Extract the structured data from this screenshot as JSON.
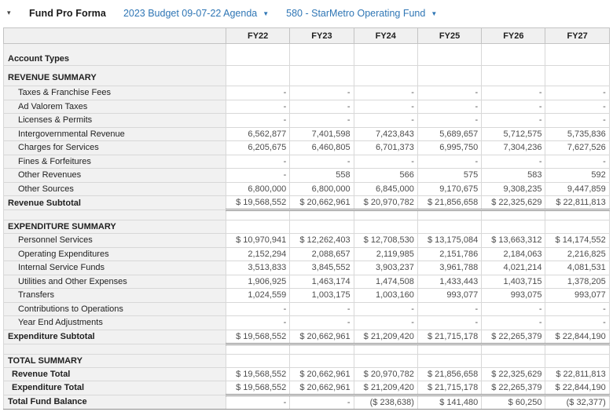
{
  "toolbar": {
    "collapse_icon": "▾",
    "title": "Fund Pro Forma",
    "budget_dropdown": {
      "label": "2023 Budget 09-07-22 Agenda",
      "caret": "▼"
    },
    "fund_dropdown": {
      "label": "580 - StarMetro Operating Fund",
      "caret": "▼"
    }
  },
  "colors": {
    "link_blue": "#2f76b5",
    "label_bg": "#f1f1f1",
    "header_bg": "#f0f0f0",
    "value_text": "#4d4d4d",
    "dark_rule": "#8f8f8f"
  },
  "table": {
    "columns": [
      "FY22",
      "FY23",
      "FY24",
      "FY25",
      "FY26",
      "FY27"
    ],
    "rows": [
      {
        "type": "account",
        "label": "Account Types",
        "values": [
          "",
          "",
          "",
          "",
          "",
          ""
        ]
      },
      {
        "type": "group_first",
        "label": "REVENUE SUMMARY",
        "values": [
          "",
          "",
          "",
          "",
          "",
          ""
        ]
      },
      {
        "type": "item",
        "label": "Taxes & Franchise Fees",
        "values": [
          "-",
          "-",
          "-",
          "-",
          "-",
          "-"
        ]
      },
      {
        "type": "item",
        "label": "Ad Valorem Taxes",
        "values": [
          "-",
          "-",
          "-",
          "-",
          "-",
          "-"
        ]
      },
      {
        "type": "item",
        "label": "Licenses & Permits",
        "values": [
          "-",
          "-",
          "-",
          "-",
          "-",
          "-"
        ]
      },
      {
        "type": "item",
        "label": "Intergovernmental Revenue",
        "values": [
          "6,562,877",
          "7,401,598",
          "7,423,843",
          "5,689,657",
          "5,712,575",
          "5,735,836"
        ]
      },
      {
        "type": "item",
        "label": "Charges for Services",
        "values": [
          "6,205,675",
          "6,460,805",
          "6,701,373",
          "6,995,750",
          "7,304,236",
          "7,627,526"
        ]
      },
      {
        "type": "item",
        "label": "Fines & Forfeitures",
        "values": [
          "-",
          "-",
          "-",
          "-",
          "-",
          "-"
        ]
      },
      {
        "type": "item",
        "label": "Other Revenues",
        "values": [
          "-",
          "558",
          "566",
          "575",
          "583",
          "592"
        ]
      },
      {
        "type": "item",
        "label": "Other Sources",
        "values": [
          "6,800,000",
          "6,800,000",
          "6,845,000",
          "9,170,675",
          "9,308,235",
          "9,447,859"
        ]
      },
      {
        "type": "subtotal",
        "label": "Revenue Subtotal",
        "values": [
          "$ 19,568,552",
          "$ 20,662,961",
          "$ 20,970,782",
          "$ 21,856,658",
          "$ 22,325,629",
          "$ 22,811,813"
        ]
      },
      {
        "type": "spacer",
        "label": "",
        "values": [
          "",
          "",
          "",
          "",
          "",
          ""
        ]
      },
      {
        "type": "group",
        "label": "EXPENDITURE SUMMARY",
        "values": [
          "",
          "",
          "",
          "",
          "",
          ""
        ]
      },
      {
        "type": "item",
        "label": "Personnel Services",
        "values": [
          "$ 10,970,941",
          "$ 12,262,403",
          "$ 12,708,530",
          "$ 13,175,084",
          "$ 13,663,312",
          "$ 14,174,552"
        ]
      },
      {
        "type": "item",
        "label": "Operating Expenditures",
        "values": [
          "2,152,294",
          "2,088,657",
          "2,119,985",
          "2,151,786",
          "2,184,063",
          "2,216,825"
        ]
      },
      {
        "type": "item",
        "label": "Internal Service Funds",
        "values": [
          "3,513,833",
          "3,845,552",
          "3,903,237",
          "3,961,788",
          "4,021,214",
          "4,081,531"
        ]
      },
      {
        "type": "item",
        "label": "Utilities and Other Expenses",
        "values": [
          "1,906,925",
          "1,463,174",
          "1,474,508",
          "1,433,443",
          "1,403,715",
          "1,378,205"
        ]
      },
      {
        "type": "item",
        "label": "Transfers",
        "values": [
          "1,024,559",
          "1,003,175",
          "1,003,160",
          "993,077",
          "993,075",
          "993,077"
        ]
      },
      {
        "type": "item",
        "label": "Contributions to Operations",
        "values": [
          "-",
          "-",
          "-",
          "-",
          "-",
          "-"
        ]
      },
      {
        "type": "item",
        "label": "Year End Adjustments",
        "values": [
          "-",
          "-",
          "-",
          "-",
          "-",
          "-"
        ]
      },
      {
        "type": "subtotal",
        "label": "Expenditure Subtotal",
        "values": [
          "$ 19,568,552",
          "$ 20,662,961",
          "$ 21,209,420",
          "$ 21,715,178",
          "$ 22,265,379",
          "$ 22,844,190"
        ]
      },
      {
        "type": "spacer",
        "label": "",
        "values": [
          "",
          "",
          "",
          "",
          "",
          ""
        ]
      },
      {
        "type": "group",
        "label": "TOTAL SUMMARY",
        "values": [
          "",
          "",
          "",
          "",
          "",
          ""
        ]
      },
      {
        "type": "total_first",
        "label": "Revenue Total",
        "values": [
          "$ 19,568,552",
          "$ 20,662,961",
          "$ 20,970,782",
          "$ 21,856,658",
          "$ 22,325,629",
          "$ 22,811,813"
        ]
      },
      {
        "type": "total_second",
        "label": "Expenditure Total",
        "values": [
          "$ 19,568,552",
          "$ 20,662,961",
          "$ 21,209,420",
          "$ 21,715,178",
          "$ 22,265,379",
          "$ 22,844,190"
        ]
      },
      {
        "type": "grand",
        "label": "Total Fund Balance",
        "values": [
          "-",
          "-",
          "($ 238,638)",
          "$ 141,480",
          "$ 60,250",
          "($ 32,377)"
        ]
      }
    ]
  }
}
